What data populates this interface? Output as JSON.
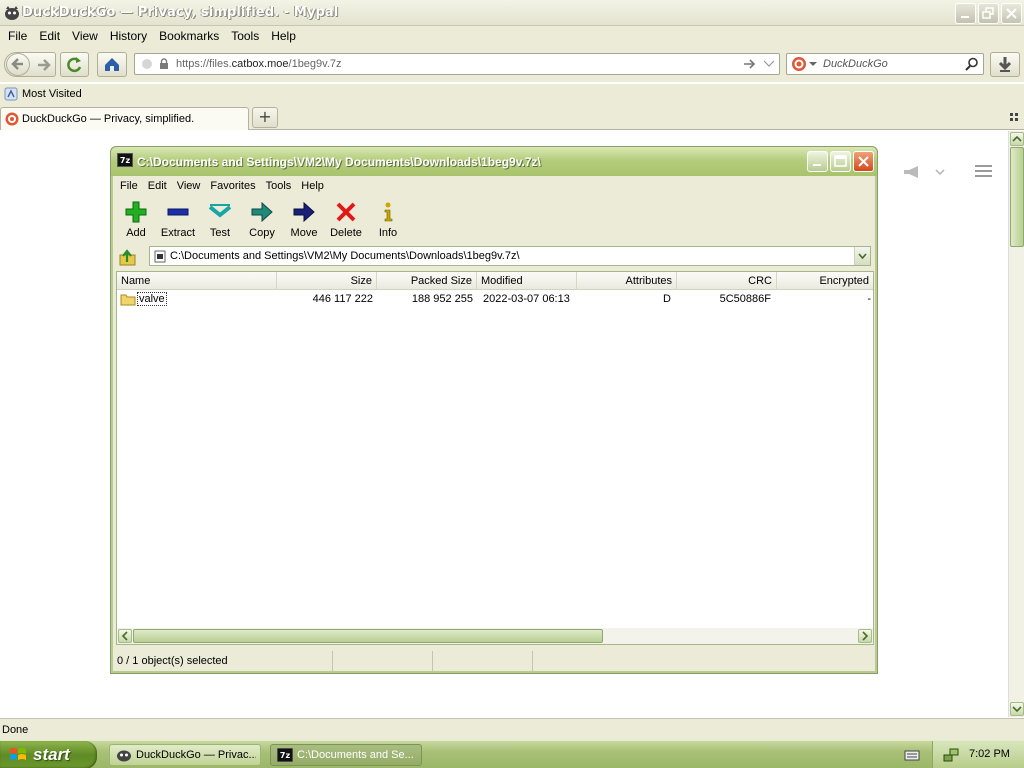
{
  "browser": {
    "title": "DuckDuckGo — Privacy, simplified. - Mypal",
    "menu": [
      "File",
      "Edit",
      "View",
      "History",
      "Bookmarks",
      "Tools",
      "Help"
    ],
    "url_prefix": "https://files.",
    "url_host": "catbox.moe",
    "url_path": "/1beg9v.7z",
    "search_placeholder": "DuckDuckGo",
    "bookmark": "Most Visited",
    "tab_label": "DuckDuckGo — Privacy, simplified.",
    "new_tab_label": "+",
    "status": "Done"
  },
  "sevenzip": {
    "title": "C:\\Documents and Settings\\VM2\\My Documents\\Downloads\\1beg9v.7z\\",
    "menu": [
      "File",
      "Edit",
      "View",
      "Favorites",
      "Tools",
      "Help"
    ],
    "tools": [
      {
        "label": "Add",
        "icon": "add-icon"
      },
      {
        "label": "Extract",
        "icon": "extract-icon"
      },
      {
        "label": "Test",
        "icon": "test-icon"
      },
      {
        "label": "Copy",
        "icon": "copy-icon"
      },
      {
        "label": "Move",
        "icon": "move-icon"
      },
      {
        "label": "Delete",
        "icon": "delete-icon"
      },
      {
        "label": "Info",
        "icon": "info-icon"
      }
    ],
    "address": "C:\\Documents and Settings\\VM2\\My Documents\\Downloads\\1beg9v.7z\\",
    "columns": [
      "Name",
      "Size",
      "Packed Size",
      "Modified",
      "Attributes",
      "CRC",
      "Encrypted"
    ],
    "rows": [
      {
        "name": "valve",
        "size": "446 117 222",
        "packed": "188 952 255",
        "modified": "2022-03-07 06:13",
        "attributes": "D",
        "crc": "5C50886F",
        "encrypted": "-"
      }
    ],
    "status": "0 / 1 object(s) selected"
  },
  "taskbar": {
    "start": "start",
    "items": [
      {
        "label": "DuckDuckGo — Privac...",
        "active": false
      },
      {
        "label": "C:\\Documents and Se...",
        "active": true
      }
    ],
    "time": "7:02 PM"
  },
  "colors": {
    "xp_olive_title": "#b4cd7d",
    "chrome_bg": "#ecebd8",
    "close_red": "#d4481c"
  }
}
